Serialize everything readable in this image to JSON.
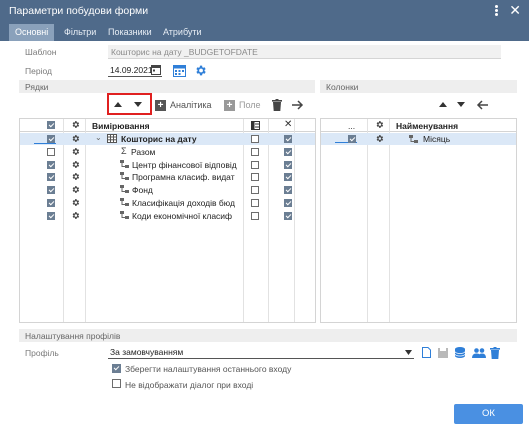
{
  "window": {
    "title": "Параметри побудови форми"
  },
  "tabs": [
    {
      "label": "Основні",
      "active": true
    },
    {
      "label": "Фільтри",
      "active": false
    },
    {
      "label": "Показники",
      "active": false
    },
    {
      "label": "Атрибути",
      "active": false
    }
  ],
  "template": {
    "label": "Шаблон",
    "value": "Кошторис на дату _BUDGETOFDATE"
  },
  "period": {
    "label": "Період",
    "value": "14.09.2021"
  },
  "rows_section": {
    "label": "Рядки"
  },
  "columns_section": {
    "label": "Колонки"
  },
  "toolbar": {
    "analytics_label": "Аналітика",
    "field_label": "Поле"
  },
  "rows_grid": {
    "header": "Вимірювання",
    "rows": [
      {
        "label": "Кошторис на дату",
        "bold": true,
        "checked_left": true,
        "checked_mid": false,
        "checked_right": true,
        "selected": true
      },
      {
        "label": "Разом",
        "bold": false,
        "checked_left": false,
        "checked_mid": false,
        "checked_right": true,
        "selected": false
      },
      {
        "label": "Центр фінансової відповід",
        "bold": false,
        "checked_left": true,
        "checked_mid": false,
        "checked_right": true,
        "selected": false
      },
      {
        "label": "Програмна класиф. видат",
        "bold": false,
        "checked_left": true,
        "checked_mid": false,
        "checked_right": true,
        "selected": false
      },
      {
        "label": "Фонд",
        "bold": false,
        "checked_left": true,
        "checked_mid": false,
        "checked_right": true,
        "selected": false
      },
      {
        "label": "Класифікація доходів бюд",
        "bold": false,
        "checked_left": true,
        "checked_mid": false,
        "checked_right": true,
        "selected": false
      },
      {
        "label": "Коди економічної класиф",
        "bold": false,
        "checked_left": true,
        "checked_mid": false,
        "checked_right": true,
        "selected": false
      }
    ]
  },
  "columns_grid": {
    "header_dots": "...",
    "header": "Найменування",
    "rows": [
      {
        "label": "Місяць",
        "checked": true,
        "selected": true
      }
    ]
  },
  "profile_section": {
    "label": "Налаштування профілів"
  },
  "profile": {
    "label": "Профіль",
    "value": "За замовчуванням",
    "save_last_label": "Зберегти налаштування останнього входу",
    "save_last_checked": true,
    "no_dialog_label": "Не відображати діалог при вході",
    "no_dialog_checked": false
  },
  "ok_label": "ОК",
  "colors": {
    "titlebar": "#4f6a8a",
    "accent": "#2f7fd8",
    "ok_button": "#4a90e2",
    "highlight": "#e02020"
  }
}
